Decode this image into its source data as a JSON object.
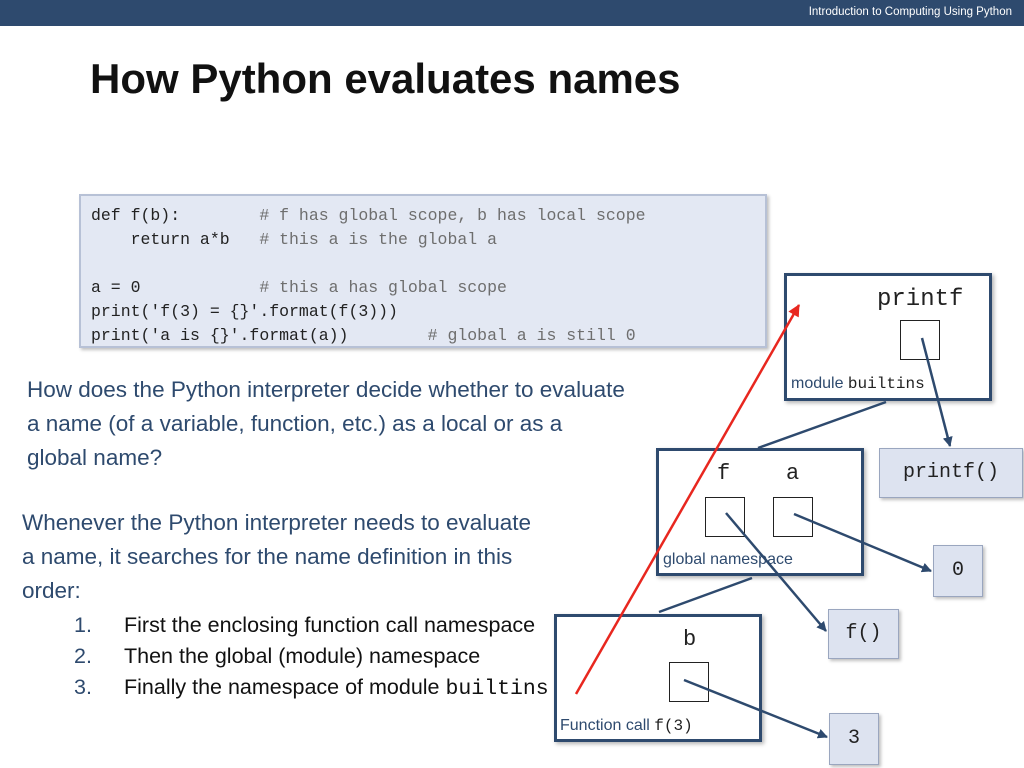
{
  "header": {
    "course": "Introduction to Computing Using Python"
  },
  "title": "How Python evaluates names",
  "code": [
    {
      "code": "def f(b):        ",
      "comment": "# f has global scope, b has local scope"
    },
    {
      "code": "    return a*b   ",
      "comment": "# this a is the global a"
    },
    {
      "code": "",
      "comment": ""
    },
    {
      "code": "a = 0            ",
      "comment": "# this a has global scope"
    },
    {
      "code": "print('f(3) = {}'.format(f(3)))",
      "comment": ""
    },
    {
      "code": "print('a is {}'.format(a))        ",
      "comment": "# global a is still 0"
    }
  ],
  "question": "How does the Python interpreter decide whether to evaluate a name (of a variable, function, etc.) as a local or as a global name?",
  "answer": "Whenever the Python interpreter needs to evaluate a name, it searches for the name definition in this order:",
  "steps": [
    {
      "num": "1.",
      "text": "First the enclosing function call namespace",
      "mono": ""
    },
    {
      "num": "2.",
      "text": "Then the global (module) namespace",
      "mono": ""
    },
    {
      "num": "3.",
      "text": "Finally the namespace of module ",
      "mono": "builtins"
    }
  ],
  "diagram": {
    "builtins_ns": {
      "name": "printf",
      "label": "module ",
      "label_mono": "builtins"
    },
    "global_ns": {
      "names": [
        "f",
        "a"
      ],
      "label": "global namespace"
    },
    "call_ns": {
      "name": "b",
      "label": "Function call ",
      "label_mono": "f(3)"
    },
    "objects": {
      "printf": "printf()",
      "zero": "0",
      "f": "f()",
      "three": "3"
    },
    "colors": {
      "namespace_border": "#2e4a6e",
      "search_arrow": "#e8271f",
      "object_fill": "#dde3f0"
    }
  }
}
